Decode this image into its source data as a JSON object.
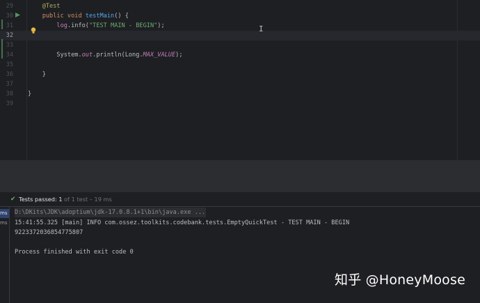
{
  "editor": {
    "lines": [
      {
        "num": "29",
        "tokens": [
          {
            "t": "    ",
            "c": ""
          },
          {
            "t": "@Test",
            "c": "tok-ann"
          }
        ]
      },
      {
        "num": "30",
        "tokens": [
          {
            "t": "    ",
            "c": ""
          },
          {
            "t": "public void ",
            "c": "tok-kw"
          },
          {
            "t": "testMain",
            "c": "tok-fn"
          },
          {
            "t": "() {",
            "c": ""
          }
        ]
      },
      {
        "num": "31",
        "tokens": [
          {
            "t": "        ",
            "c": ""
          },
          {
            "t": "log",
            "c": "tok-log"
          },
          {
            "t": ".info(",
            "c": ""
          },
          {
            "t": "\"TEST MAIN - BEGIN\"",
            "c": "tok-str"
          },
          {
            "t": ");",
            "c": ""
          }
        ]
      },
      {
        "num": "32",
        "tokens": []
      },
      {
        "num": "33",
        "tokens": []
      },
      {
        "num": "34",
        "tokens": [
          {
            "t": "        System.",
            "c": ""
          },
          {
            "t": "out",
            "c": "tok-static"
          },
          {
            "t": ".println(Long.",
            "c": ""
          },
          {
            "t": "MAX_VALUE",
            "c": "tok-const"
          },
          {
            "t": ");",
            "c": ""
          }
        ]
      },
      {
        "num": "35",
        "tokens": []
      },
      {
        "num": "36",
        "tokens": [
          {
            "t": "    }",
            "c": ""
          }
        ]
      },
      {
        "num": "37",
        "tokens": []
      },
      {
        "num": "38",
        "tokens": [
          {
            "t": "}",
            "c": ""
          }
        ]
      },
      {
        "num": "39",
        "tokens": []
      }
    ],
    "current_line": "32",
    "gutter_icons": [
      "run-test-icon",
      "intention-bulb-icon"
    ]
  },
  "run_panel": {
    "status": {
      "icon": "check-icon",
      "label": "Tests passed: ",
      "passed": "1",
      "detail": " of 1 test – 19 ms"
    },
    "left_items": [
      "ms",
      "ms"
    ],
    "console_lines": [
      "D:\\DKits\\JDK\\adoptium\\jdk-17.0.8.1+1\\bin\\java.exe ...",
      "15:41:55.325 [main] INFO com.ossez.toolkits.codebank.tests.EmptyQuickTest - TEST MAIN - BEGIN",
      "9223372036854775807",
      "",
      "Process finished with exit code 0"
    ]
  },
  "watermark": "知乎 @HoneyMoose",
  "colors": {
    "editor_bg": "#1e1f22",
    "keyword": "#cf8e6d",
    "string": "#6aab73",
    "function": "#56a8f5",
    "annotation": "#b3ae60",
    "static_field": "#c77dbb",
    "success": "#5fb865"
  }
}
